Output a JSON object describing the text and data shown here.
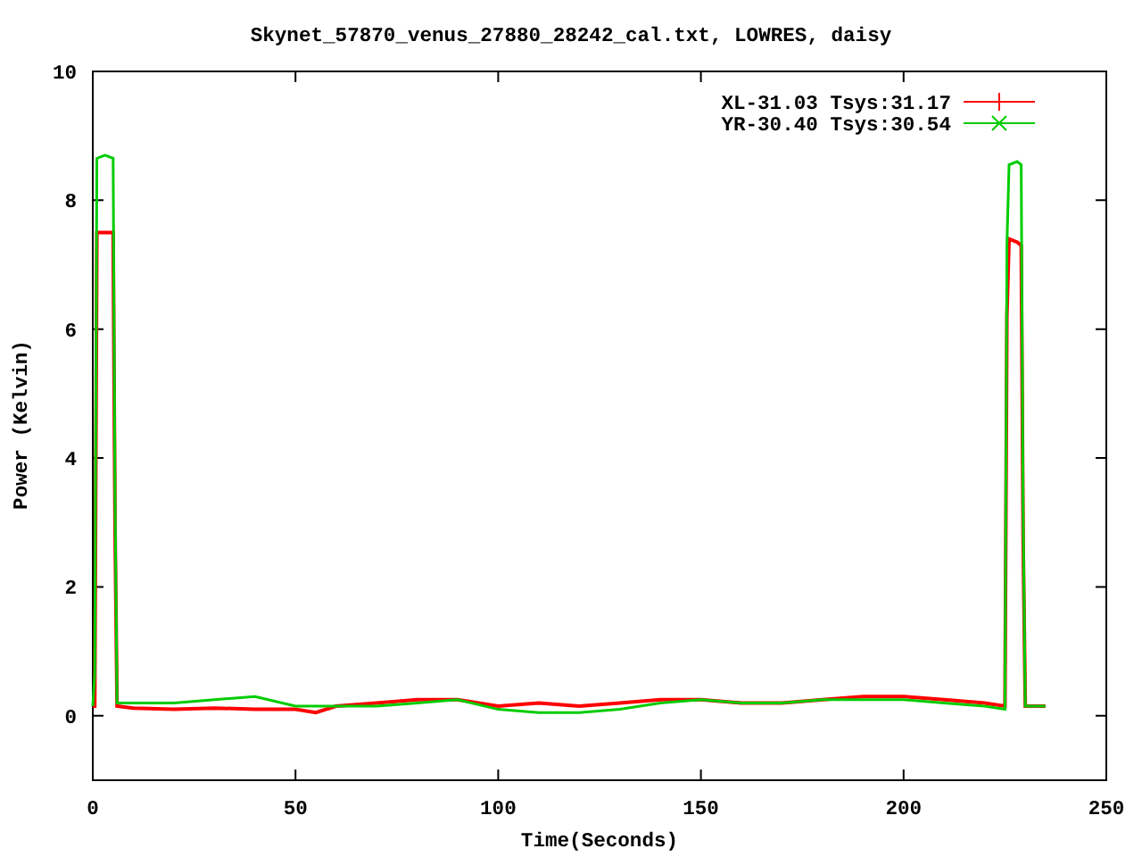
{
  "chart_data": {
    "type": "line",
    "title": "Skynet_57870_venus_27880_28242_cal.txt, LOWRES, daisy",
    "xlabel": "Time(Seconds)",
    "ylabel": "Power (Kelvin)",
    "x": [
      0,
      0.5,
      1,
      3,
      5,
      5.5,
      6,
      10,
      20,
      30,
      40,
      50,
      55,
      60,
      70,
      80,
      90,
      100,
      110,
      120,
      130,
      140,
      150,
      160,
      170,
      180,
      190,
      200,
      210,
      220,
      225,
      225.5,
      226,
      228,
      229,
      229.5,
      230,
      235
    ],
    "series": [
      {
        "name": "XL-31.03 Tsys:31.17",
        "color": "#ff0000",
        "values": [
          0.15,
          0.15,
          7.5,
          7.5,
          7.5,
          2.85,
          0.15,
          0.12,
          0.1,
          0.12,
          0.1,
          0.1,
          0.05,
          0.15,
          0.2,
          0.25,
          0.25,
          0.15,
          0.2,
          0.15,
          0.2,
          0.25,
          0.25,
          0.2,
          0.2,
          0.25,
          0.3,
          0.3,
          0.25,
          0.2,
          0.15,
          6.2,
          7.4,
          7.35,
          7.3,
          2.7,
          0.15,
          0.15
        ]
      },
      {
        "name": "YR-30.40 Tsys:30.54",
        "color": "#00cc00",
        "values": [
          0.15,
          0.65,
          8.65,
          8.7,
          8.65,
          3.3,
          0.2,
          0.2,
          0.2,
          0.25,
          0.3,
          0.15,
          0.15,
          0.15,
          0.15,
          0.2,
          0.25,
          0.1,
          0.05,
          0.05,
          0.1,
          0.2,
          0.25,
          0.2,
          0.2,
          0.25,
          0.25,
          0.25,
          0.2,
          0.15,
          0.1,
          7.3,
          8.55,
          8.6,
          8.55,
          3.1,
          0.15,
          0.15
        ]
      }
    ],
    "legend": true,
    "xlim": [
      0,
      250
    ],
    "ylim": [
      -1,
      10
    ],
    "xticks": [
      0,
      50,
      100,
      150,
      200,
      250
    ],
    "yticks": [
      0,
      2,
      4,
      6,
      8,
      10
    ]
  }
}
